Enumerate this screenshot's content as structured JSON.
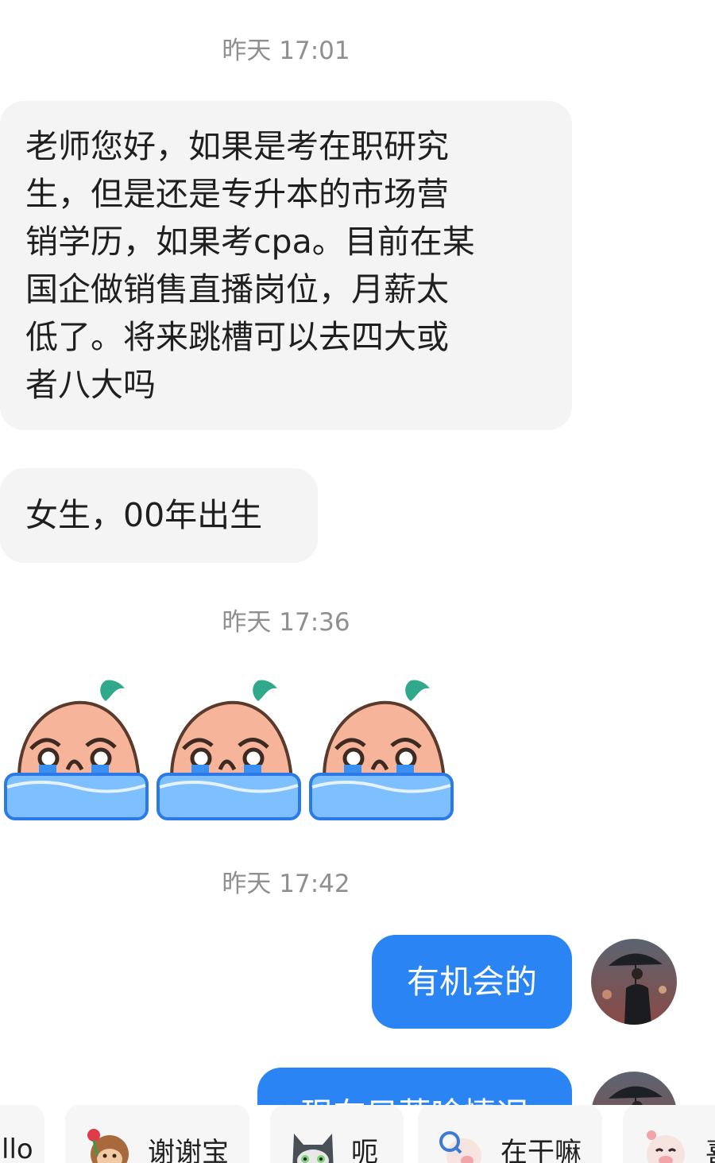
{
  "timestamps": [
    "昨天 17:01",
    "昨天 17:36",
    "昨天 17:42"
  ],
  "messages": {
    "m1_lines": [
      "老师您好，如果是考在职研究",
      "生，但是还是专升本的市场营",
      "销学历，如果考cpa。目前在某",
      "国企做销售直播岗位，月薪太",
      "低了。将来跳槽可以去四大或",
      "者八大吗"
    ],
    "m2": "女生，00年出生",
    "m3": "有机会的",
    "m4": "现在只落啥情况"
  },
  "stickers": [
    "crying-peach-sticker",
    "crying-peach-sticker",
    "crying-peach-sticker"
  ],
  "quick_replies": [
    {
      "label": "llo",
      "icon": ""
    },
    {
      "label": "谢谢宝",
      "icon": "monkey-flower-icon"
    },
    {
      "label": "呃",
      "icon": "grey-cat-icon"
    },
    {
      "label": "在干嘛",
      "icon": "pig-magnifier-icon"
    },
    {
      "label": "喜",
      "icon": "pig-happy-icon"
    }
  ],
  "colors": {
    "accent": "#2b84f4",
    "incoming_bg": "#f4f4f4",
    "timestamp": "#8f8f8f"
  }
}
